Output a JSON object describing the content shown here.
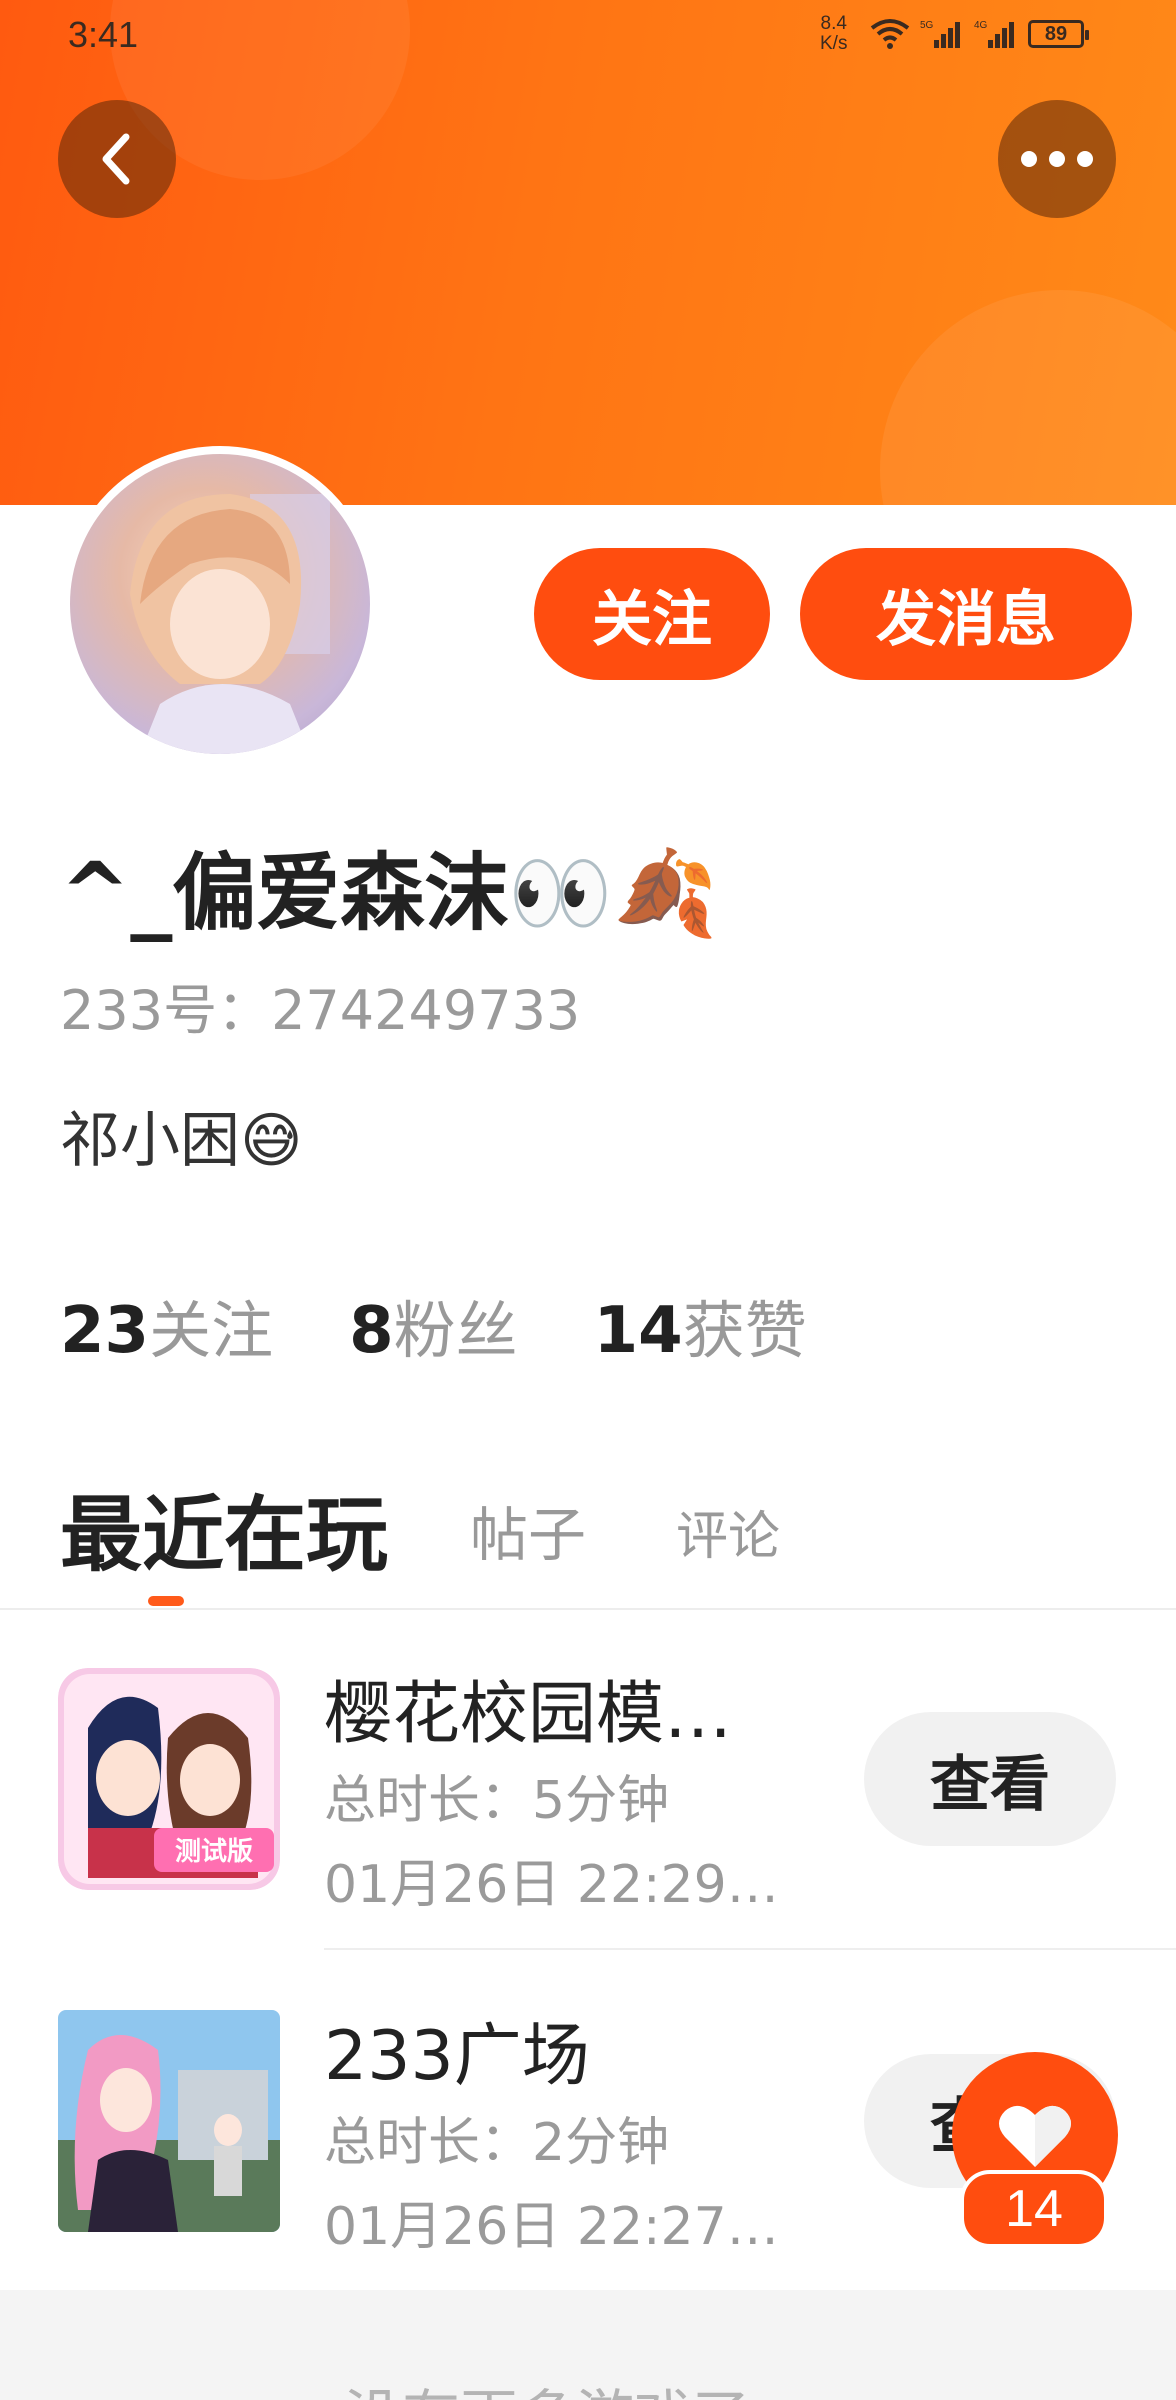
{
  "status_bar": {
    "time": "3:41",
    "net_speed_value": "8.4",
    "net_speed_unit": "K/s",
    "battery": "89",
    "icons": [
      "wifi-icon",
      "5g-signal-icon",
      "4g-signal-icon",
      "battery-icon"
    ]
  },
  "header": {
    "back_icon": "chevron-left-icon",
    "more_icon": "more-dots-icon",
    "colors": {
      "gradient_start": "#ff5a10",
      "gradient_end": "#ff8a18"
    }
  },
  "profile": {
    "follow_label": "关注",
    "message_label": "发消息",
    "username": "^_偏爱森沫👀🍂",
    "id_text": "233号：274249733",
    "bio": "祁小困😅"
  },
  "stats": [
    {
      "value": "23",
      "label": "关注"
    },
    {
      "value": "8",
      "label": "粉丝"
    },
    {
      "value": "14",
      "label": "获赞"
    }
  ],
  "tabs": {
    "active": "最近在玩",
    "posts": "帖子",
    "comments": "评论"
  },
  "games": [
    {
      "name": "樱花校园模…",
      "duration": "总时长：5分钟",
      "time": "01月26日 22:29…",
      "view_label": "查看",
      "icon_badge": "测试版"
    },
    {
      "name": "233广场",
      "duration": "总时长：2分钟",
      "time": "01月26日 22:27…",
      "view_label": "查看"
    }
  ],
  "footer": {
    "text": "没有更多游戏了"
  },
  "like": {
    "icon": "heart-icon",
    "count": "14"
  },
  "accent_color": "#ff4d0f"
}
